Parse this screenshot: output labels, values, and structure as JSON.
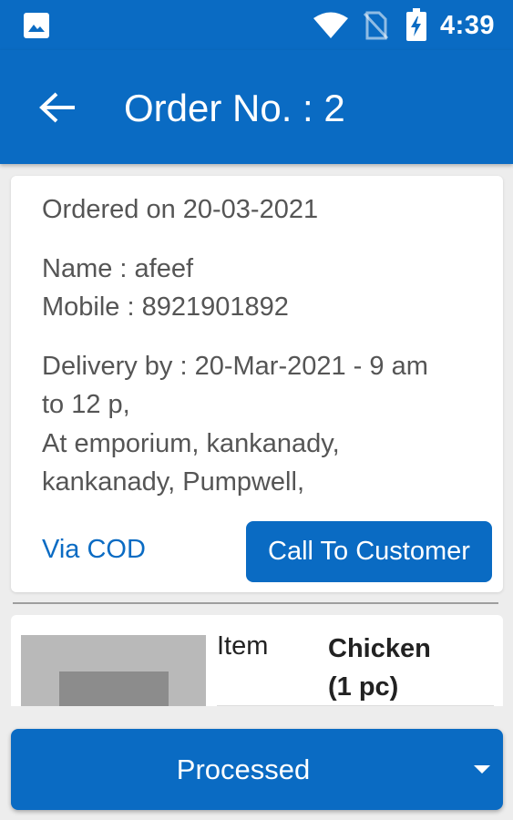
{
  "status_bar": {
    "time": "4:39",
    "icons": [
      "image-icon",
      "wifi-icon",
      "no-sim-icon",
      "battery-charging-icon"
    ]
  },
  "app_bar": {
    "title": "Order No. : 2",
    "back_icon": "arrow-left-icon"
  },
  "order": {
    "ordered_on": "Ordered on 20-03-2021",
    "name": "Name : afeef",
    "mobile": "Mobile : 8921901892",
    "delivery_line1": "Delivery by : 20-Mar-2021 - 9 am",
    "delivery_line2": "to 12 p,",
    "address_line1": "At emporium, kankanady,",
    "address_line2": "kankanady, Pumpwell,",
    "payment": "Via COD",
    "call_label": "Call To Customer"
  },
  "item": {
    "label": "Item",
    "value_line1": "Chicken",
    "value_line2": "(1 pc)"
  },
  "status_select": {
    "selected": "Processed"
  },
  "colors": {
    "primary": "#0a6bc3",
    "background": "#ededed",
    "text_secondary": "#555555"
  }
}
